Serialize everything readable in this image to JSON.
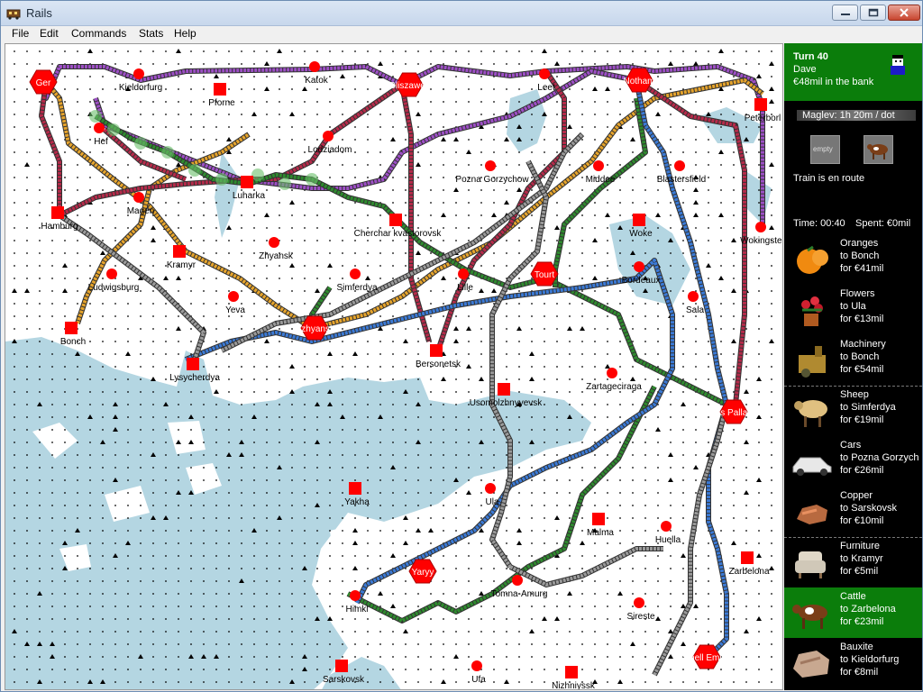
{
  "window": {
    "title": "Rails"
  },
  "menu": [
    "File",
    "Edit",
    "Commands",
    "Stats",
    "Help"
  ],
  "map": {
    "cities": [
      {
        "name": "Ger",
        "kind": "major"
      },
      {
        "name": "Kieldorfurg",
        "kind": "town"
      },
      {
        "name": "Pforne",
        "kind": "city"
      },
      {
        "name": "Katok",
        "kind": "town"
      },
      {
        "name": "Gliszawek",
        "kind": "major"
      },
      {
        "name": "Leet",
        "kind": "town"
      },
      {
        "name": "Notham",
        "kind": "major"
      },
      {
        "name": "Peterborl",
        "kind": "city"
      },
      {
        "name": "Hef",
        "kind": "town"
      },
      {
        "name": "Lodziadom",
        "kind": "town"
      },
      {
        "name": "Pozna Gorzychow",
        "kind": "town"
      },
      {
        "name": "Middee",
        "kind": "town"
      },
      {
        "name": "Blastersfield",
        "kind": "town"
      },
      {
        "name": "Luharka",
        "kind": "city"
      },
      {
        "name": "Magen",
        "kind": "town"
      },
      {
        "name": "Hamburg",
        "kind": "city"
      },
      {
        "name": "Cherchar kvastorovsk",
        "kind": "city"
      },
      {
        "name": "Woke",
        "kind": "city"
      },
      {
        "name": "Wokingster",
        "kind": "town"
      },
      {
        "name": "Zhyansk",
        "kind": "town"
      },
      {
        "name": "Kramyr",
        "kind": "city"
      },
      {
        "name": "Ludwigsburg",
        "kind": "town"
      },
      {
        "name": "Simferdya",
        "kind": "town"
      },
      {
        "name": "Lille",
        "kind": "town"
      },
      {
        "name": "Tourt",
        "kind": "major"
      },
      {
        "name": "Bordeaux",
        "kind": "town"
      },
      {
        "name": "Yeva",
        "kind": "town"
      },
      {
        "name": "Sala",
        "kind": "town"
      },
      {
        "name": "Bonch",
        "kind": "city"
      },
      {
        "name": "Uzhyansk",
        "kind": "major"
      },
      {
        "name": "Lysycherdya",
        "kind": "city"
      },
      {
        "name": "Bersonetsk",
        "kind": "city"
      },
      {
        "name": "Zartageciraga",
        "kind": "town"
      },
      {
        "name": "Usomolzhnyyevsk",
        "kind": "city"
      },
      {
        "name": "Gras Pallagoz",
        "kind": "major"
      },
      {
        "name": "Yakha",
        "kind": "city"
      },
      {
        "name": "Ula",
        "kind": "town"
      },
      {
        "name": "Malma",
        "kind": "city"
      },
      {
        "name": "Huella",
        "kind": "town"
      },
      {
        "name": "Yaryy",
        "kind": "major"
      },
      {
        "name": "Zarbelona",
        "kind": "city"
      },
      {
        "name": "Tomna-Amurg",
        "kind": "town"
      },
      {
        "name": "Himki",
        "kind": "town"
      },
      {
        "name": "Sireste",
        "kind": "town"
      },
      {
        "name": "Vicenell Emilanto",
        "kind": "major"
      },
      {
        "name": "Sarskovsk",
        "kind": "city"
      },
      {
        "name": "Ufa",
        "kind": "town"
      },
      {
        "name": "Nizhniyssk",
        "kind": "city"
      }
    ],
    "colors": {
      "sea": "#b4d6e2",
      "land": "#ffffff",
      "city": "#ff0000",
      "track_purple": "#9d4fc6",
      "track_orange": "#e6a42c",
      "track_red": "#b62a4a",
      "track_green": "#2e8a2e",
      "track_blue": "#3b7ad6",
      "track_gray": "#9a9a9a"
    }
  },
  "panel": {
    "turn": "Turn 40",
    "player": "Dave",
    "bank": "€48mil in the bank",
    "train_speed": "Maglev: 1h 20m / dot",
    "wagon_empty": "empty",
    "status": "Train is en route",
    "time": "Time: 00:40",
    "spent": "Spent: €0mil",
    "cargo": [
      {
        "good": "Oranges",
        "to": "to Bonch",
        "pay": "for €41mil",
        "icon": "orange-icon"
      },
      {
        "good": "Flowers",
        "to": "to Ula",
        "pay": "for €13mil",
        "icon": "flowers-icon"
      },
      {
        "good": "Machinery",
        "to": "to Bonch",
        "pay": "for €54mil",
        "icon": "machinery-icon"
      },
      {
        "good": "Sheep",
        "to": "to Simferdya",
        "pay": "for €19mil",
        "icon": "sheep-icon"
      },
      {
        "good": "Cars",
        "to": "to Pozna Gorzych",
        "pay": "for €26mil",
        "icon": "car-icon"
      },
      {
        "good": "Copper",
        "to": "to Sarskovsk",
        "pay": "for €10mil",
        "icon": "copper-icon"
      },
      {
        "good": "Furniture",
        "to": "to Kramyr",
        "pay": "for €5mil",
        "icon": "armchair-icon"
      },
      {
        "good": "Cattle",
        "to": "to Zarbelona",
        "pay": "for €23mil",
        "icon": "cow-icon",
        "highlight": true
      },
      {
        "good": "Bauxite",
        "to": "to Kieldorfurg",
        "pay": "for €8mil",
        "icon": "bauxite-icon"
      }
    ]
  }
}
